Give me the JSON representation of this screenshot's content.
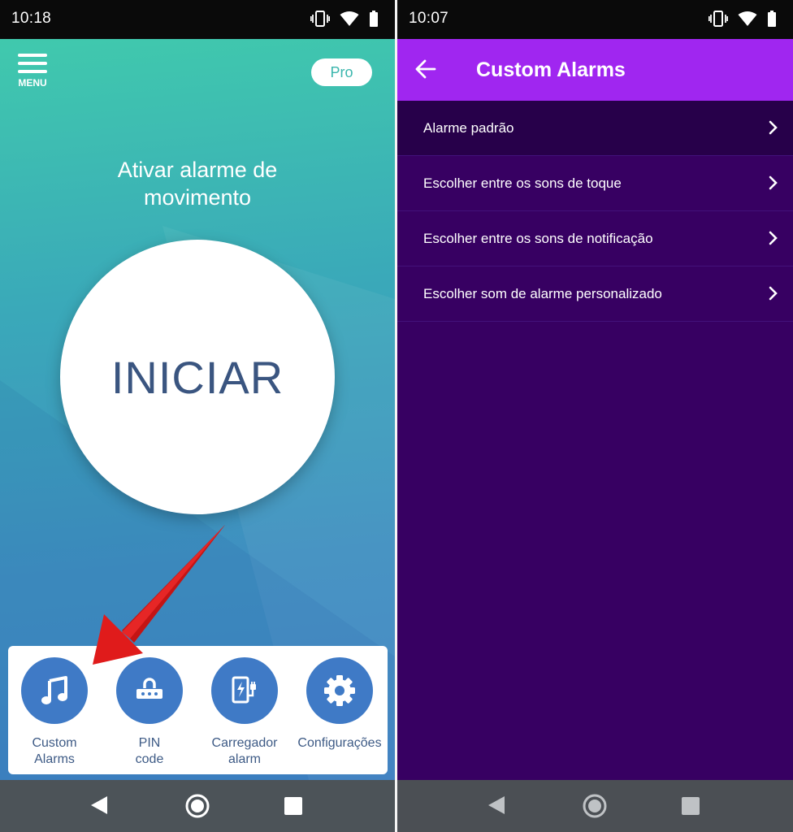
{
  "left": {
    "status": {
      "time": "10:18"
    },
    "menu_label": "MENU",
    "pro_label": "Pro",
    "headline": "Ativar alarme de movimento",
    "start_label": "INICIAR",
    "tray": [
      {
        "label": "Custom Alarms",
        "icon": "music-note-icon"
      },
      {
        "label": "PIN code",
        "icon": "pin-keypad-icon"
      },
      {
        "label": "Carregador alarm",
        "icon": "charger-icon"
      },
      {
        "label": "Configurações",
        "icon": "gear-icon"
      }
    ],
    "colors": {
      "gradient_top": "#40c9ad",
      "gradient_bottom": "#3f83c3",
      "start_text": "#3a5580",
      "tray_icon_bg": "#3f7ac6",
      "annotation_arrow": "#e01b1b"
    }
  },
  "right": {
    "status": {
      "time": "10:07"
    },
    "title": "Custom Alarms",
    "items": [
      {
        "label": "Alarme padrão"
      },
      {
        "label": "Escolher entre os sons de toque"
      },
      {
        "label": "Escolher entre os sons de notificação"
      },
      {
        "label": "Escolher som de alarme personalizado"
      }
    ],
    "colors": {
      "appbar": "#a026f0",
      "background": "#370062",
      "selected_row": "#27004a"
    }
  }
}
